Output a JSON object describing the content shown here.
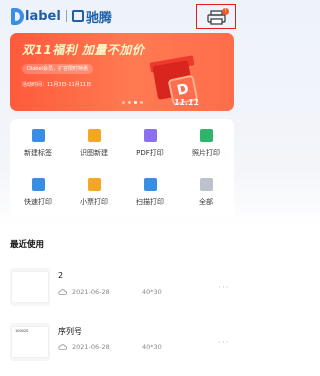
{
  "header": {
    "brand_latin": "label",
    "brand_cn": "驰腾",
    "printer_icon": "printer-icon",
    "printer_badge": "!"
  },
  "banner": {
    "title": "双11福利 加量不加价",
    "subtitle": "Dlabel会员，扩容限时特惠",
    "date_text": "活动时间：11月3日-11月11日",
    "badge_text": "11.11",
    "logo_letter": "D",
    "slide_count": 4,
    "active_slide": 2,
    "accent": "#ff5a3c"
  },
  "tools": [
    {
      "label": "新建标签",
      "icon": "new-label-icon",
      "color": "#3a8ee6"
    },
    {
      "label": "识图新建",
      "icon": "scan-create-icon",
      "color": "#f5a623"
    },
    {
      "label": "PDF打印",
      "icon": "pdf-print-icon",
      "color": "#8b6ff0"
    },
    {
      "label": "照片打印",
      "icon": "photo-print-icon",
      "color": "#2fb56b"
    },
    {
      "label": "快速打印",
      "icon": "quick-print-icon",
      "color": "#3a8ee6"
    },
    {
      "label": "小票打印",
      "icon": "receipt-print-icon",
      "color": "#f5a623"
    },
    {
      "label": "扫描打印",
      "icon": "scan-print-icon",
      "color": "#3a8ee6"
    },
    {
      "label": "全部",
      "icon": "all-grid-icon",
      "color": "#bcc3cc"
    }
  ],
  "recent": {
    "title": "最近使用",
    "items": [
      {
        "name": "2",
        "date": "2021-06-28",
        "size": "40*30",
        "thumb_text": ""
      },
      {
        "name": "序列号",
        "date": "2021-06-28",
        "size": "40*30",
        "thumb_text": "100020"
      }
    ],
    "more_label": "···"
  }
}
